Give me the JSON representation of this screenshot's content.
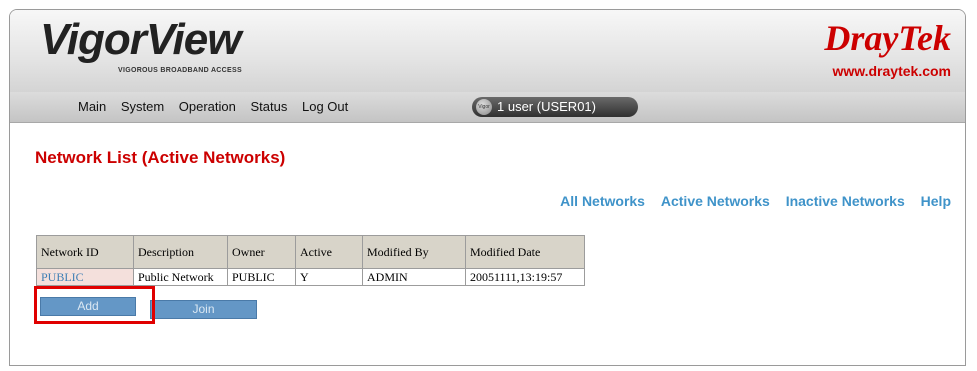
{
  "header": {
    "vigor_logo": "VigorView",
    "vigor_tagline": "VIGOROUS BROADBAND ACCESS",
    "draytek_logo": "DrayTek",
    "draytek_url": "www.draytek.com"
  },
  "menu": {
    "items": [
      "Main",
      "System",
      "Operation",
      "Status",
      "Log Out"
    ]
  },
  "user": {
    "icon_label": "Vigor",
    "text": "1 user (USER01)"
  },
  "page": {
    "title": "Network List (Active Networks)"
  },
  "filter_links": [
    "All Networks",
    "Active Networks",
    "Inactive Networks",
    "Help"
  ],
  "table": {
    "columns": [
      "Network ID",
      "Description",
      "Owner",
      "Active",
      "Modified By",
      "Modified Date"
    ],
    "rows": [
      [
        "PUBLIC",
        "Public Network",
        "PUBLIC",
        "Y",
        "ADMIN",
        "20051111,13:19:57"
      ]
    ]
  },
  "buttons": {
    "add": "Add",
    "join": "Join"
  },
  "colors": {
    "brand_red": "#cc0000",
    "link_blue": "#3f93c9",
    "button_blue": "#6497c6",
    "highlight": "#e00000"
  }
}
